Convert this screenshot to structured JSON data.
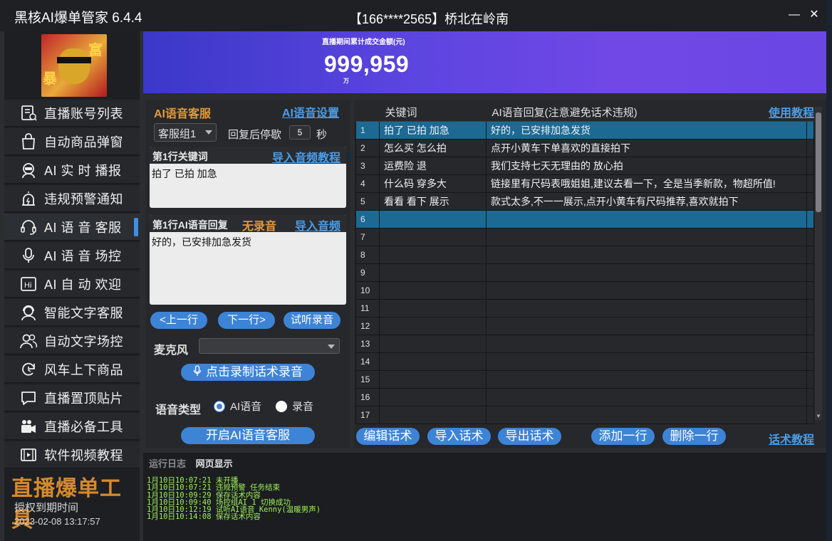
{
  "window": {
    "app_title": "黑核AI爆单管家 6.4.4",
    "user_title": "【166****2565】桥北在岭南",
    "minimize_glyph": "—",
    "close_glyph": "✕"
  },
  "sidebar": {
    "avatar_chars": [
      "暴",
      "富"
    ],
    "items": [
      {
        "label": "直播账号列表",
        "icon": "account-list-icon"
      },
      {
        "label": "自动商品弹窗",
        "icon": "shopping-bag-icon"
      },
      {
        "label": "AI 实 时 播报",
        "icon": "robot-voice-icon"
      },
      {
        "label": "违规预警通知",
        "icon": "alert-icon"
      },
      {
        "label": "AI 语 音 客服",
        "icon": "headset-icon"
      },
      {
        "label": "AI 语 音 场控",
        "icon": "microphone-icon"
      },
      {
        "label": "AI 自 动 欢迎",
        "icon": "hi-icon"
      },
      {
        "label": "智能文字客服",
        "icon": "agent-icon"
      },
      {
        "label": "自动文字场控",
        "icon": "users-icon"
      },
      {
        "label": "风车上下商品",
        "icon": "refresh-icon"
      },
      {
        "label": "直播置顶贴片",
        "icon": "pin-chat-icon"
      },
      {
        "label": "直播必备工具",
        "icon": "camera-icon"
      },
      {
        "label": "软件视频教程",
        "icon": "video-icon"
      }
    ],
    "active_index": 4,
    "brand": "直播爆单工具",
    "expire_label": "授权到期时间",
    "expire_time": "2023-02-08 13:17:57"
  },
  "banner": {
    "label": "直播期间累计成交金额(元)",
    "value": "999,959",
    "unit": "万"
  },
  "voice_service": {
    "title": "AI语音客服",
    "settings_link": "AI语音设置",
    "group_select": "客服组1",
    "pause_label": "回复后停歇",
    "pause_value": "5",
    "pause_unit": "秒",
    "keyword_box": {
      "label": "第1行关键词",
      "link": "导入音频教程",
      "content": "拍了 已拍 加急"
    },
    "reply_box": {
      "label": "第1行AI语音回复",
      "warning": "无录音",
      "link": "导入音频",
      "content": "好的，已安排加急发货"
    },
    "prev_button": "<上一行",
    "next_button": "下一行>",
    "listen_button": "试听录音",
    "mic_label": "麦克风",
    "record_button": "点击录制话术录音",
    "voice_type_label": "语音类型",
    "voice_options": [
      "AI语音",
      "录音"
    ],
    "voice_selected": "AI语音",
    "start_button": "开启AI语音客服"
  },
  "table": {
    "col_keyword": "关键词",
    "col_reply": "AI语音回复(注意避免话术违规)",
    "help_link": "使用教程",
    "rows": [
      {
        "num": "1",
        "keyword": "拍了 已拍 加急",
        "reply": "好的，已安排加急发货"
      },
      {
        "num": "2",
        "keyword": "怎么买 怎么拍",
        "reply": "点开小黄车下单喜欢的直接拍下"
      },
      {
        "num": "3",
        "keyword": "运费险 退",
        "reply": "我们支持七天无理由的  放心拍"
      },
      {
        "num": "4",
        "keyword": "什么码 穿多大",
        "reply": "链接里有尺码表哦姐姐,建议去看一下，全是当季新款，物超所值!"
      },
      {
        "num": "5",
        "keyword": "看看 看下 展示",
        "reply": "款式太多,不一一展示,点开小黄车有尺码推荐,喜欢就拍下"
      },
      {
        "num": "6",
        "keyword": "",
        "reply": ""
      },
      {
        "num": "7",
        "keyword": "",
        "reply": ""
      },
      {
        "num": "8",
        "keyword": "",
        "reply": ""
      },
      {
        "num": "9",
        "keyword": "",
        "reply": ""
      },
      {
        "num": "10",
        "keyword": "",
        "reply": ""
      },
      {
        "num": "11",
        "keyword": "",
        "reply": ""
      },
      {
        "num": "12",
        "keyword": "",
        "reply": ""
      },
      {
        "num": "13",
        "keyword": "",
        "reply": ""
      },
      {
        "num": "14",
        "keyword": "",
        "reply": ""
      },
      {
        "num": "15",
        "keyword": "",
        "reply": ""
      },
      {
        "num": "16",
        "keyword": "",
        "reply": ""
      },
      {
        "num": "17",
        "keyword": "",
        "reply": ""
      }
    ],
    "selected_rows": [
      1,
      6
    ],
    "buttons": {
      "edit": "编辑话术",
      "import": "导入话术",
      "export": "导出话术",
      "add_row": "添加一行",
      "delete_row": "删除一行"
    },
    "script_tutorial": "话术教程"
  },
  "log": {
    "tab_log": "运行日志",
    "tab_web": "网页显示",
    "lines": [
      "1月10日10:07:21 未开播",
      "1月10日10:07:21 违规预警 任务结束",
      "1月10日10:09:29 保存话术内容",
      "1月10日10:09:40 场控组AI 1 切换成功",
      "1月10日10:12:19 试听AI语音 Kenny(温暖男声)",
      "1月10日10:14:08 保存话术内容"
    ]
  },
  "colors": {
    "accent": "#3d84d6",
    "link": "#4a9de8",
    "warning": "#e39a3a",
    "selected_row": "#1c6a94",
    "log_text": "#9ff15a",
    "banner_start": "#3b38c8",
    "banner_end": "#7148e6"
  }
}
